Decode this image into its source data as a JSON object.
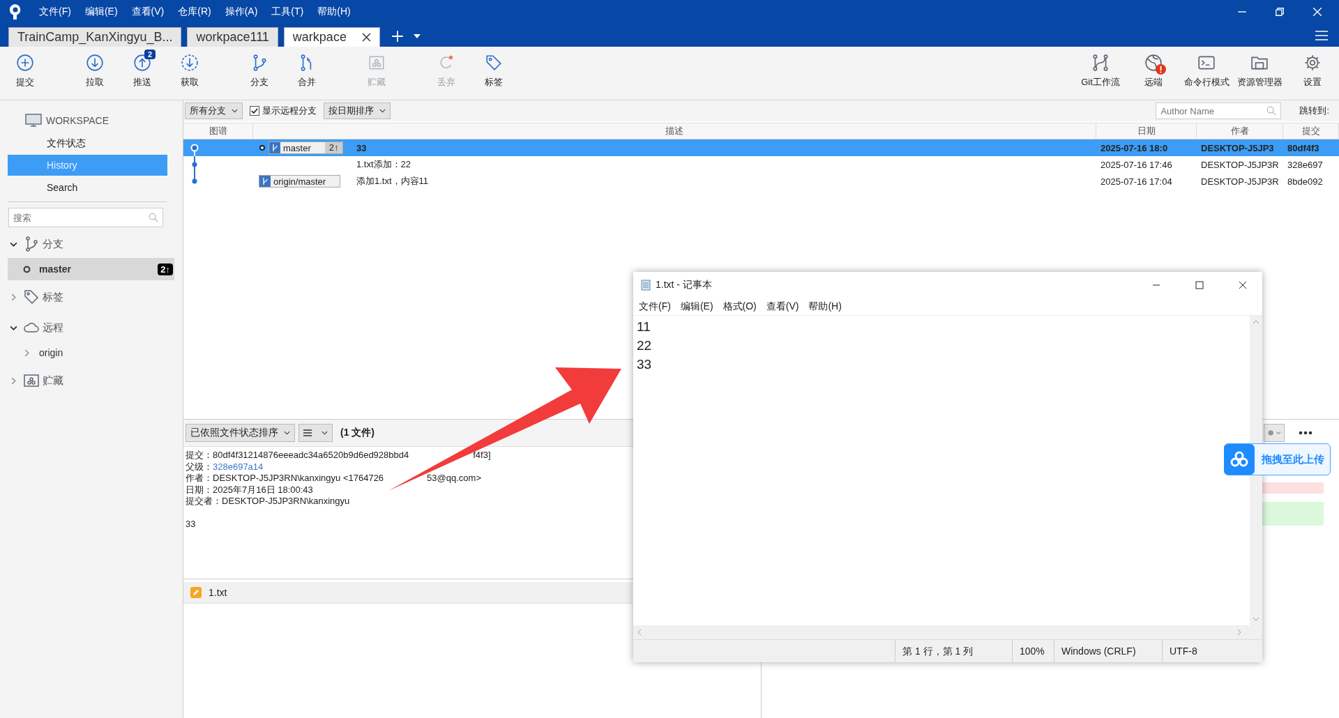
{
  "app_menu": [
    "文件(F)",
    "编辑(E)",
    "查看(V)",
    "仓库(R)",
    "操作(A)",
    "工具(T)",
    "帮助(H)"
  ],
  "repo_tabs": [
    {
      "label": "TrainCamp_KanXingyu_B...",
      "selected": false
    },
    {
      "label": "workpace111",
      "selected": false
    },
    {
      "label": "warkpace",
      "selected": true
    }
  ],
  "toolbar_left": [
    {
      "label": "提交",
      "disabled": false
    },
    {
      "label": "拉取",
      "disabled": false
    },
    {
      "label": "推送",
      "disabled": false,
      "badge": "2"
    },
    {
      "label": "获取",
      "disabled": false
    },
    {
      "label": "分支",
      "disabled": false
    },
    {
      "label": "合并",
      "disabled": false
    },
    {
      "label": "贮藏",
      "disabled": true
    },
    {
      "label": "丢弃",
      "disabled": true
    },
    {
      "label": "标签",
      "disabled": false
    }
  ],
  "toolbar_right": [
    {
      "label": "Git工作流",
      "alert": false
    },
    {
      "label": "远端",
      "alert": true
    },
    {
      "label": "命令行模式",
      "alert": false
    },
    {
      "label": "资源管理器",
      "alert": false
    },
    {
      "label": "设置",
      "alert": false
    }
  ],
  "sidebar": {
    "workspace_title": "WORKSPACE",
    "workspace_items": [
      {
        "label": "文件状态",
        "selected": false
      },
      {
        "label": "History",
        "selected": true
      },
      {
        "label": "Search",
        "selected": false
      }
    ],
    "search_placeholder": "搜索",
    "sections": [
      {
        "label": "分支",
        "expanded": true,
        "children": [
          {
            "label": "master",
            "kind": "branch",
            "selected": true,
            "badge": "2↑"
          }
        ]
      },
      {
        "label": "标签",
        "expanded": false
      },
      {
        "label": "远程",
        "expanded": true,
        "children": [
          {
            "label": "origin",
            "kind": "remote",
            "selected": false
          }
        ]
      },
      {
        "label": "贮藏",
        "expanded": false
      }
    ]
  },
  "history": {
    "branch_select": "所有分支",
    "show_remote": {
      "label": "显示远程分支",
      "checked": true
    },
    "sort_select": "按日期排序",
    "author_placeholder": "Author Name",
    "jump_label": "跳转到:",
    "columns": [
      "图谱",
      "描述",
      "日期",
      "作者",
      "提交"
    ],
    "rows": [
      {
        "selected": true,
        "head": true,
        "refs": [
          {
            "label": "master",
            "current": true,
            "badge": "2↑"
          }
        ],
        "description": "33",
        "date": "2025-07-16 18:0",
        "author": "DESKTOP-J5JP3",
        "commit": "80df4f3"
      },
      {
        "selected": false,
        "head": false,
        "refs": [],
        "description": "1.txt添加：22",
        "date": "2025-07-16 17:46",
        "author": "DESKTOP-J5JP3R",
        "commit": "328e697"
      },
      {
        "selected": false,
        "head": false,
        "refs": [
          {
            "label": "origin/master",
            "current": false
          }
        ],
        "description": "添加1.txt，内容11",
        "date": "2025-07-16 17:04",
        "author": "DESKTOP-J5JP3R",
        "commit": "8bde092"
      }
    ]
  },
  "details": {
    "sort_select": "已依照文件状态排序",
    "file_count": "(1 文件)",
    "lines": [
      {
        "label": "提交：",
        "value": "80df4f31214876eeeadc34a6520b9d6ed928bbd4",
        "value_after": "f4f3]"
      },
      {
        "label": "父级：",
        "value": "328e697a14",
        "kind": "link"
      },
      {
        "label": "作者：",
        "value": "DESKTOP-J5JP3RN\\kanxingyu <1764726",
        "value_after": "53@qq.com>"
      },
      {
        "label": "日期：",
        "value": "2025年7月16日 18:00:43"
      },
      {
        "label": "提交者：",
        "value": "DESKTOP-J5JP3RN\\kanxingyu"
      }
    ],
    "message": "33",
    "files": [
      {
        "name": "1.txt",
        "kind": "modified"
      }
    ]
  },
  "notepad": {
    "title": "1.txt - 记事本",
    "menu": [
      "文件(F)",
      "编辑(E)",
      "格式(O)",
      "查看(V)",
      "帮助(H)"
    ],
    "lines": [
      "11",
      "22",
      "33"
    ],
    "status": [
      "第 1 行，第 1 列",
      "100%",
      "Windows (CRLF)",
      "UTF-8"
    ]
  },
  "upload_widget": {
    "label": "拖拽至此上传"
  }
}
